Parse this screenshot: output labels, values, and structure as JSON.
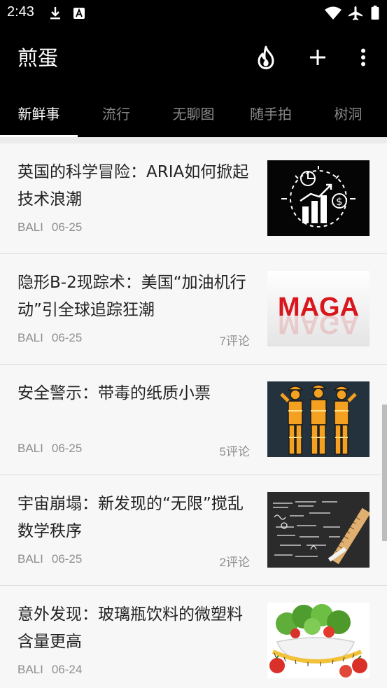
{
  "status_bar": {
    "time": "2:43",
    "icons": [
      "download-icon",
      "text-notification-icon",
      "wifi-icon",
      "airplane-mode-icon",
      "battery-icon"
    ]
  },
  "app_bar": {
    "title": "煎蛋",
    "actions": [
      "hot-icon",
      "add-icon",
      "more-vert-icon"
    ]
  },
  "tabs": [
    {
      "label": "新鲜事",
      "active": true
    },
    {
      "label": "流行",
      "active": false
    },
    {
      "label": "无聊图",
      "active": false
    },
    {
      "label": "随手拍",
      "active": false
    },
    {
      "label": "树洞",
      "active": false
    }
  ],
  "articles": [
    {
      "title": "英国的科学冒险：ARIA如何掀起技术浪潮",
      "author": "BALI",
      "date": "06-25",
      "comments": "",
      "thumbnail": "growth-chart-icon-image"
    },
    {
      "title": "隐形B-2现踪术：美国“加油机行动”引全球追踪狂潮",
      "author": "BALI",
      "date": "06-25",
      "comments": "7评论",
      "thumbnail": "maga-text-image",
      "thumb_text": "MAGA"
    },
    {
      "title": "安全警示：带毒的纸质小票",
      "author": "BALI",
      "date": "06-25",
      "comments": "5评论",
      "thumbnail": "construction-workers-image"
    },
    {
      "title": "宇宙崩塌：新发现的“无限”搅乱数学秩序",
      "author": "BALI",
      "date": "06-25",
      "comments": "2评论",
      "thumbnail": "chalkboard-equations-image"
    },
    {
      "title": "意外发现：玻璃瓶饮料的微塑料含量更高",
      "author": "BALI",
      "date": "06-24",
      "comments": "",
      "thumbnail": "salad-bowl-image"
    }
  ],
  "colors": {
    "app_bar_bg": "#000000",
    "tab_inactive": "#8a8a8a",
    "tab_active": "#ffffff",
    "card_bg": "#f7f7f7",
    "meta_text": "#8e8e8e"
  }
}
